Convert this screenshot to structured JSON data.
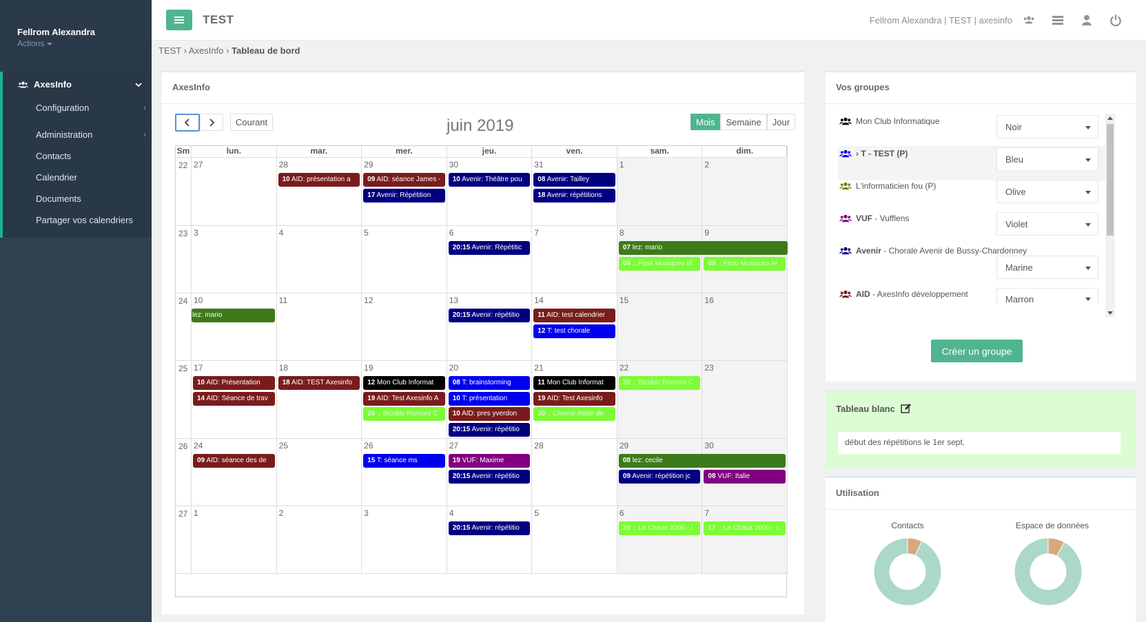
{
  "sidebar": {
    "user_name": "Fellrom Alexandra",
    "user_actions": "Actions",
    "main_item": "AxesInfo",
    "items": [
      {
        "label": "Configuration",
        "has_arrow": true
      },
      {
        "label": "Administration",
        "has_arrow": true
      },
      {
        "label": "Contacts",
        "has_arrow": false
      },
      {
        "label": "Calendrier",
        "has_arrow": false
      },
      {
        "label": "Documents",
        "has_arrow": false
      },
      {
        "label": "Partager vos calendriers",
        "has_arrow": false
      }
    ]
  },
  "topbar": {
    "title": "TEST",
    "user_info": "Fellrom Alexandra | TEST | axesinfo",
    "icons": [
      "users-icon",
      "list-icon",
      "user-icon",
      "power-icon"
    ]
  },
  "breadcrumb": {
    "a": "TEST",
    "b": "AxesInfo",
    "c": "Tableau de bord",
    "sep": "›"
  },
  "calendar": {
    "panel_title": "AxesInfo",
    "today_label": "Courant",
    "title": "juin 2019",
    "views": [
      "Mois",
      "Semaine",
      "Jour"
    ],
    "active_view": "Mois",
    "week_head": "Sm",
    "day_headers": [
      "lun.",
      "mar.",
      "mer.",
      "jeu.",
      "ven.",
      "sam.",
      "dim."
    ],
    "weeks": [
      {
        "num": "22",
        "days": [
          "27",
          "28",
          "29",
          "30",
          "31",
          "1",
          "2"
        ]
      },
      {
        "num": "23",
        "days": [
          "3",
          "4",
          "5",
          "6",
          "7",
          "8",
          "9"
        ]
      },
      {
        "num": "24",
        "days": [
          "10",
          "11",
          "12",
          "13",
          "14",
          "15",
          "16"
        ]
      },
      {
        "num": "25",
        "days": [
          "17",
          "18",
          "19",
          "20",
          "21",
          "22",
          "23"
        ]
      },
      {
        "num": "26",
        "days": [
          "24",
          "25",
          "26",
          "27",
          "28",
          "29",
          "30"
        ]
      },
      {
        "num": "27",
        "days": [
          "1",
          "2",
          "3",
          "4",
          "5",
          "6",
          "7"
        ]
      }
    ],
    "events": [
      {
        "w": 0,
        "d": 1,
        "span": 1,
        "slot": 0,
        "time": "10",
        "text": "AID: présentation a",
        "color": "#7a1c1c"
      },
      {
        "w": 0,
        "d": 2,
        "span": 1,
        "slot": 0,
        "time": "09",
        "text": "AID: séance James -",
        "color": "#7a1c1c"
      },
      {
        "w": 0,
        "d": 2,
        "span": 1,
        "slot": 1,
        "time": "17",
        "text": "Avenir: Répétition",
        "color": "#000080"
      },
      {
        "w": 0,
        "d": 3,
        "span": 1,
        "slot": 0,
        "time": "10",
        "text": "Avenir: Théâtre pou",
        "color": "#000080"
      },
      {
        "w": 0,
        "d": 4,
        "span": 1,
        "slot": 0,
        "time": "08",
        "text": "Avenir: Tailley",
        "color": "#000080"
      },
      {
        "w": 0,
        "d": 4,
        "span": 1,
        "slot": 1,
        "time": "18",
        "text": "Avenir: répétitions",
        "color": "#000080"
      },
      {
        "w": 1,
        "d": 3,
        "span": 1,
        "slot": 0,
        "time": "20:15",
        "text": "Avenir: Répétitic",
        "color": "#000080"
      },
      {
        "w": 1,
        "d": 5,
        "span": 2,
        "slot": 0,
        "time": "07",
        "text": "lez: mario",
        "color": "#3d7a1a",
        "open_right": true
      },
      {
        "w": 1,
        "d": 5,
        "span": 1,
        "slot": 1,
        "time": "09",
        "text": ".: Festi Musiques M",
        "color": "#7cfc36"
      },
      {
        "w": 1,
        "d": 6,
        "span": 1,
        "slot": 1,
        "time": "09",
        "text": ".: Festi Musiques M",
        "color": "#7cfc36"
      },
      {
        "w": 2,
        "d": 0,
        "span": 1,
        "slot": 0,
        "time": "",
        "text": "lez: mario",
        "color": "#3d7a1a",
        "open_left": true
      },
      {
        "w": 2,
        "d": 3,
        "span": 1,
        "slot": 0,
        "time": "20:15",
        "text": "Avenir: répétitio",
        "color": "#000080"
      },
      {
        "w": 2,
        "d": 4,
        "span": 1,
        "slot": 0,
        "time": "11",
        "text": "AID: test calendrier",
        "color": "#7a1c1c"
      },
      {
        "w": 2,
        "d": 4,
        "span": 1,
        "slot": 1,
        "time": "12",
        "text": "T: test chorale",
        "color": "#0000ee"
      },
      {
        "w": 3,
        "d": 0,
        "span": 1,
        "slot": 0,
        "time": "10",
        "text": "AID: Présentation",
        "color": "#7a1c1c"
      },
      {
        "w": 3,
        "d": 0,
        "span": 1,
        "slot": 1,
        "time": "14",
        "text": "AID: Séance de trav",
        "color": "#7a1c1c"
      },
      {
        "w": 3,
        "d": 1,
        "span": 1,
        "slot": 0,
        "time": "18",
        "text": "AID: TEST Axesinfo",
        "color": "#7a1c1c"
      },
      {
        "w": 3,
        "d": 2,
        "span": 1,
        "slot": 0,
        "time": "12",
        "text": "Mon Club Informat",
        "color": "#000000"
      },
      {
        "w": 3,
        "d": 2,
        "span": 1,
        "slot": 1,
        "time": "19",
        "text": "AID: Test Axesinfo A",
        "color": "#7a1c1c"
      },
      {
        "w": 3,
        "d": 2,
        "span": 1,
        "slot": 2,
        "time": "20",
        "text": ".: Bicubic Romont C",
        "color": "#7cfc36"
      },
      {
        "w": 3,
        "d": 3,
        "span": 1,
        "slot": 0,
        "time": "08",
        "text": "T: brainstorming",
        "color": "#0000ee"
      },
      {
        "w": 3,
        "d": 3,
        "span": 1,
        "slot": 1,
        "time": "10",
        "text": "T: présentation",
        "color": "#0000ee"
      },
      {
        "w": 3,
        "d": 3,
        "span": 1,
        "slot": 2,
        "time": "10",
        "text": "AID: pres yverdon",
        "color": "#7a1c1c"
      },
      {
        "w": 3,
        "d": 3,
        "span": 1,
        "slot": 3,
        "time": "20:15",
        "text": "Avenir: répétitio",
        "color": "#000080"
      },
      {
        "w": 3,
        "d": 4,
        "span": 1,
        "slot": 0,
        "time": "11",
        "text": "Mon Club Informat",
        "color": "#000000"
      },
      {
        "w": 3,
        "d": 4,
        "span": 1,
        "slot": 1,
        "time": "19",
        "text": "AID: Test Axesinfo",
        "color": "#7a1c1c"
      },
      {
        "w": 3,
        "d": 4,
        "span": 1,
        "slot": 2,
        "time": "20",
        "text": ".: Choeur mixte de",
        "color": "#7cfc36"
      },
      {
        "w": 3,
        "d": 5,
        "span": 1,
        "slot": 0,
        "time": "20",
        "text": ".: Bicubic Romont C",
        "color": "#7cfc36"
      },
      {
        "w": 4,
        "d": 0,
        "span": 1,
        "slot": 0,
        "time": "09",
        "text": "AID: séance des de",
        "color": "#7a1c1c"
      },
      {
        "w": 4,
        "d": 2,
        "span": 1,
        "slot": 0,
        "time": "15",
        "text": "T: séance ms",
        "color": "#0000ee"
      },
      {
        "w": 4,
        "d": 3,
        "span": 1,
        "slot": 0,
        "time": "19",
        "text": "VUF: Maxime",
        "color": "#800080"
      },
      {
        "w": 4,
        "d": 3,
        "span": 1,
        "slot": 1,
        "time": "20:15",
        "text": "Avenir: répétitio",
        "color": "#000080"
      },
      {
        "w": 4,
        "d": 5,
        "span": 2,
        "slot": 0,
        "time": "08",
        "text": "lez: cecile",
        "color": "#3d7a1a"
      },
      {
        "w": 4,
        "d": 5,
        "span": 1,
        "slot": 1,
        "time": "09",
        "text": "Avenir: répétition jc",
        "color": "#000080"
      },
      {
        "w": 4,
        "d": 6,
        "span": 1,
        "slot": 1,
        "time": "08",
        "text": "VUF: Italie",
        "color": "#800080"
      },
      {
        "w": 5,
        "d": 3,
        "span": 1,
        "slot": 0,
        "time": "20:15",
        "text": "Avenir: répétitio",
        "color": "#000080"
      },
      {
        "w": 5,
        "d": 5,
        "span": 1,
        "slot": 0,
        "time": "20",
        "text": ".: La Chaux 2000 - L",
        "color": "#7cfc36"
      },
      {
        "w": 5,
        "d": 6,
        "span": 1,
        "slot": 0,
        "time": "17",
        "text": ".: La Chaux 2000 - L",
        "color": "#7cfc36"
      }
    ]
  },
  "groups": {
    "title": "Vos groupes",
    "create_label": "Créer un groupe",
    "items": [
      {
        "code": "",
        "name": "Mon Club Informatique",
        "color_label": "Noir",
        "icon_color": "#000000"
      },
      {
        "code": "› T - TEST (P)",
        "name": "",
        "color_label": "Bleu",
        "icon_color": "#0000ee"
      },
      {
        "code": "",
        "name": "L'informaticien fou (P)",
        "color_label": "Olive",
        "icon_color": "#808000"
      },
      {
        "code": "VUF",
        "name": " - Vufflens",
        "color_label": "Violet",
        "icon_color": "#800080"
      },
      {
        "code": "Avenir",
        "name": " - Chorale Avenir de Bussy-Chardonney",
        "color_label": "Marine",
        "icon_color": "#000080"
      },
      {
        "code": "AID",
        "name": " - AxesInfo développement",
        "color_label": "Marron",
        "icon_color": "#7a1c1c"
      }
    ]
  },
  "whiteboard": {
    "title": "Tableau blanc",
    "text": "début des répétitions le 1er sept."
  },
  "usage": {
    "title": "Utilisation",
    "charts": [
      {
        "label": "Contacts",
        "used_fraction": 0.07
      },
      {
        "label": "Espace de données",
        "used_fraction": 0.08
      }
    ]
  },
  "colors": {
    "accent": "#4fb58f",
    "sidebar": "#2f4050",
    "used": "#d8a77e",
    "free": "#acd8c8"
  }
}
